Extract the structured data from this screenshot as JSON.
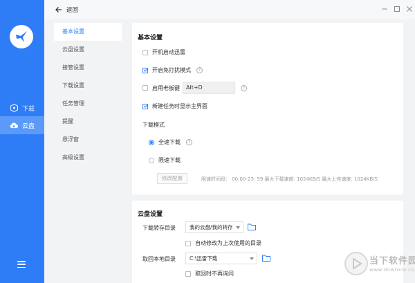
{
  "app": {
    "accent": "#2f7df6",
    "sidebar": [
      {
        "label": "下载",
        "icon": "download-hex-icon",
        "active": false
      },
      {
        "label": "云盘",
        "icon": "cloud-icon",
        "active": true
      }
    ]
  },
  "topbar": {
    "back_label": "返回"
  },
  "settings_nav": [
    {
      "label": "基本设置",
      "active": true
    },
    {
      "label": "云盘设置"
    },
    {
      "label": "接管设置"
    },
    {
      "label": "下载设置"
    },
    {
      "label": "任务管理"
    },
    {
      "label": "提醒"
    },
    {
      "label": "悬浮窗"
    },
    {
      "label": "高级设置"
    }
  ],
  "basic": {
    "title": "基本设置",
    "autostart": {
      "label": "开机启动迅雷",
      "checked": false
    },
    "dnd": {
      "label": "开启免打扰模式",
      "checked": true
    },
    "boss_key": {
      "label": "启用老板键",
      "checked": false,
      "value": "Alt+D"
    },
    "show_main": {
      "label": "新建任务时显示主界面",
      "checked": true
    },
    "download_mode": {
      "title": "下载模式",
      "full_speed": "全速下载",
      "limited": "限速下载",
      "edit_button": "修改配置",
      "limit_info": "限速时间段： 00:00-23: 59   最大下载速度: 1024KB/S     最大上传速度: 1024KB/S"
    }
  },
  "cloud": {
    "title": "云盘设置",
    "save_dir_label": "下载转存目录",
    "save_dir_value": "我的云盘/我的转存",
    "auto_modify": "自动修改为上次使用的目录",
    "local_dir_label": "取回本地目录",
    "local_dir_value": "C:\\迅雷下载",
    "no_ask": "取回时不再询问"
  },
  "watermark": {
    "line1": "当下软件园",
    "line2": "www.downxia.com"
  }
}
